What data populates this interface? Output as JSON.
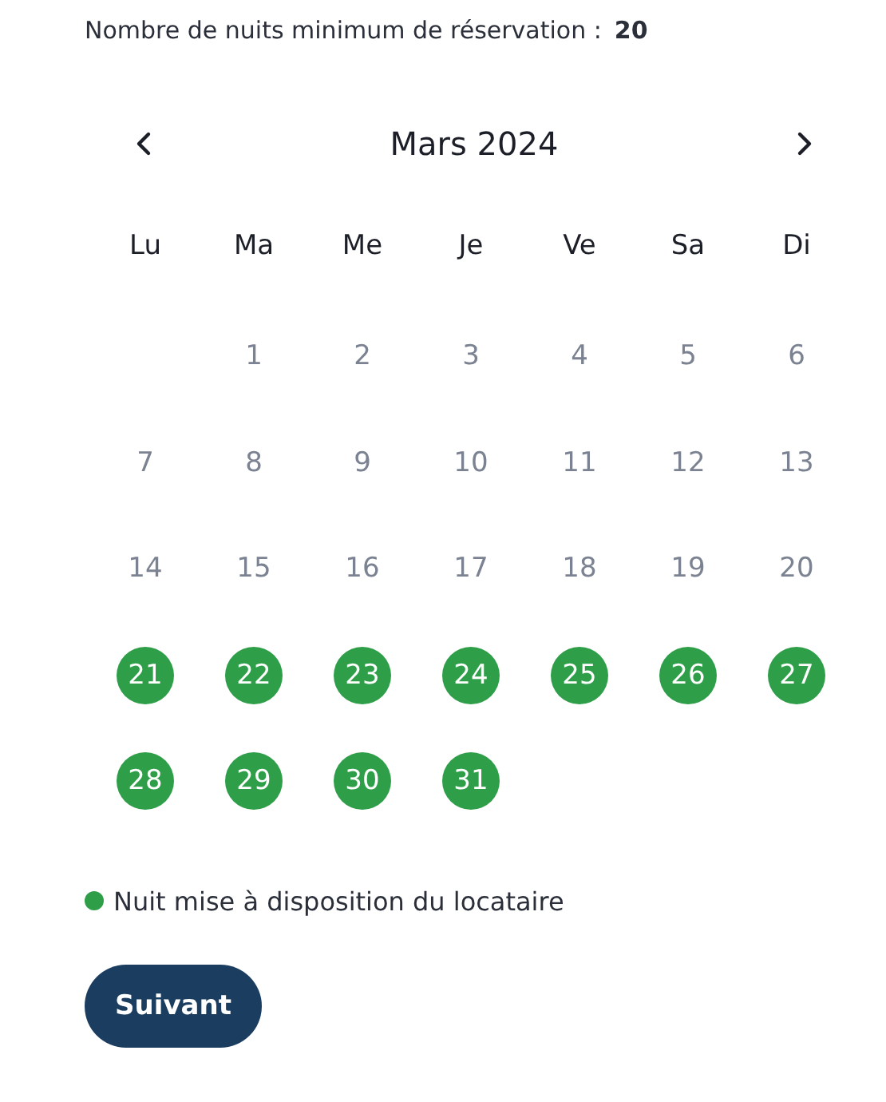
{
  "minimum_nights": {
    "label": "Nombre de nuits minimum de réservation :",
    "value": "20"
  },
  "calendar": {
    "month": "Mars 2024",
    "weekdays": [
      "Lu",
      "Ma",
      "Me",
      "Je",
      "Ve",
      "Sa",
      "Di"
    ],
    "weeks": [
      [
        {
          "day": "1",
          "available": false
        },
        {
          "day": "2",
          "available": false
        },
        {
          "day": "3",
          "available": false
        },
        {
          "day": "4",
          "available": false
        },
        {
          "day": "5",
          "available": false
        },
        {
          "day": "6",
          "available": false
        }
      ],
      [
        {
          "day": "7",
          "available": false
        },
        {
          "day": "8",
          "available": false
        },
        {
          "day": "9",
          "available": false
        },
        {
          "day": "10",
          "available": false
        },
        {
          "day": "11",
          "available": false
        },
        {
          "day": "12",
          "available": false
        },
        {
          "day": "13",
          "available": false
        }
      ],
      [
        {
          "day": "14",
          "available": false
        },
        {
          "day": "15",
          "available": false
        },
        {
          "day": "16",
          "available": false
        },
        {
          "day": "17",
          "available": false
        },
        {
          "day": "18",
          "available": false
        },
        {
          "day": "19",
          "available": false
        },
        {
          "day": "20",
          "available": false
        }
      ],
      [
        {
          "day": "21",
          "available": true
        },
        {
          "day": "22",
          "available": true
        },
        {
          "day": "23",
          "available": true
        },
        {
          "day": "24",
          "available": true
        },
        {
          "day": "25",
          "available": true
        },
        {
          "day": "26",
          "available": true
        },
        {
          "day": "27",
          "available": true
        }
      ],
      [
        {
          "day": "28",
          "available": true
        },
        {
          "day": "29",
          "available": true
        },
        {
          "day": "30",
          "available": true
        },
        {
          "day": "31",
          "available": true
        }
      ]
    ]
  },
  "legend": {
    "label": "Nuit mise à disposition du locataire",
    "color": "#2e9e48"
  },
  "buttons": [
    "Suivant"
  ]
}
